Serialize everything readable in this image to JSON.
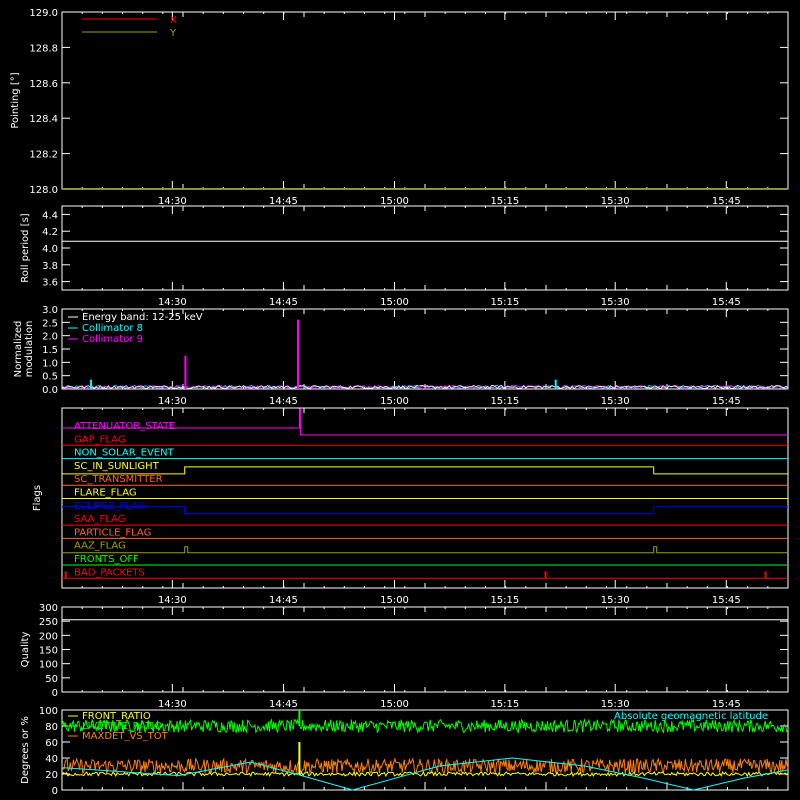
{
  "colors": {
    "background": "#000000",
    "axes": "#ffffff",
    "red": "#ff0000",
    "yellow": "#ffff00",
    "olive": "#a0a000",
    "cyan": "#00ffff",
    "magenta": "#ff00ff",
    "orange": "#ff8000",
    "blue": "#0000ff",
    "green": "#00ff00",
    "salmon": "#ff6030"
  },
  "chart_data": [
    {
      "id": "pointing",
      "type": "line",
      "ylabel": "Pointing [°]",
      "ylim": [
        128.0,
        129.0
      ],
      "yticks": [
        "128.0",
        "128.2",
        "128.4",
        "128.6",
        "128.8",
        "129.0"
      ],
      "xticks": [
        "14:30",
        "14:45",
        "15:00",
        "15:15",
        "15:30",
        "15:45"
      ],
      "legend": "top-left",
      "series": [
        {
          "name": "X",
          "color": "red",
          "y": null
        },
        {
          "name": "Y",
          "color": "olive",
          "y": 128.0
        }
      ]
    },
    {
      "id": "roll",
      "type": "line",
      "ylabel": "Roll period [s]",
      "ylim": [
        3.5,
        4.5
      ],
      "yticks": [
        "3.6",
        "3.8",
        "4.0",
        "4.2",
        "4.4"
      ],
      "xticks": [
        "14:30",
        "14:45",
        "15:00",
        "15:15",
        "15:30",
        "15:45"
      ],
      "series": [
        {
          "name": "",
          "color": "axes",
          "y": 4.08
        }
      ]
    },
    {
      "id": "modulation",
      "type": "line",
      "ylabel": [
        "Normalized",
        "modulation"
      ],
      "ylim": [
        0.0,
        3.0
      ],
      "yticks": [
        "0.0",
        "0.5",
        "1.0",
        "1.5",
        "2.0",
        "2.5",
        "3.0"
      ],
      "xticks": [
        "14:30",
        "14:45",
        "15:00",
        "15:15",
        "15:30",
        "15:45"
      ],
      "legend": "top-left",
      "legend_entries": [
        {
          "name": "Energy band: 12-25 keV",
          "color": "axes"
        },
        {
          "name": "Collimator 8",
          "color": "cyan"
        },
        {
          "name": "Collimator 9",
          "color": "magenta"
        }
      ],
      "baseline": 0.05,
      "spikes": [
        {
          "t": 0.04,
          "value": 0.35,
          "color": "cyan"
        },
        {
          "t": 0.17,
          "value": 1.25,
          "color": "magenta"
        },
        {
          "t": 0.325,
          "value": 2.6,
          "color": "magenta"
        },
        {
          "t": 0.68,
          "value": 0.35,
          "color": "cyan"
        }
      ]
    },
    {
      "id": "flags",
      "type": "line",
      "ylabel": "Flags",
      "xticks": [
        "14:30",
        "14:45",
        "15:00",
        "15:15",
        "15:30",
        "15:45"
      ],
      "flags": [
        {
          "name": "ATTENUATOR_STATE",
          "color": "magenta",
          "pattern": "attenuator"
        },
        {
          "name": "GAP_FLAG",
          "color": "red",
          "pattern": "flat"
        },
        {
          "name": "NON_SOLAR_EVENT",
          "color": "cyan",
          "pattern": "flat"
        },
        {
          "name": "SC_IN_SUNLIGHT",
          "color": "yellow",
          "pattern": "sunlight"
        },
        {
          "name": "SC_TRANSMITTER",
          "color": "salmon",
          "pattern": "flat"
        },
        {
          "name": "FLARE_FLAG",
          "color": "yellow",
          "pattern": "flat"
        },
        {
          "name": "ECLIPSE_FLAG",
          "color": "blue",
          "pattern": "eclipse"
        },
        {
          "name": "SAA_FLAG",
          "color": "red",
          "pattern": "flat"
        },
        {
          "name": "PARTICLE_FLAG",
          "color": "salmon",
          "pattern": "flat"
        },
        {
          "name": "AAZ_FLAG",
          "color": "olive",
          "pattern": "aaz"
        },
        {
          "name": "FRONTS_OFF",
          "color": "green",
          "pattern": "flat"
        },
        {
          "name": "BAD_PACKETS",
          "color": "red",
          "pattern": "badpackets"
        }
      ]
    },
    {
      "id": "quality",
      "type": "line",
      "ylabel": "Quality",
      "ylim": [
        0,
        300
      ],
      "yticks": [
        "0",
        "50",
        "100",
        "150",
        "200",
        "250",
        "300"
      ],
      "xticks": [
        "14:30",
        "14:45",
        "15:00",
        "15:15",
        "15:30",
        "15:45"
      ],
      "series": [
        {
          "name": "",
          "color": "axes",
          "y": 255
        }
      ]
    },
    {
      "id": "ratios",
      "type": "line",
      "ylabel": "Degrees or %",
      "ylim": [
        0,
        100
      ],
      "yticks": [
        "0",
        "20",
        "40",
        "60",
        "80",
        "100"
      ],
      "legend": "top-left",
      "legend_entries": [
        {
          "name": "FRONT_RATIO",
          "color": "yellow"
        },
        {
          "name": "LIVETIME_RATIO",
          "color": "green"
        },
        {
          "name": "MAXDET_VS_TOT",
          "color": "orange"
        }
      ],
      "annotation": {
        "text": "Absolute geomagnetic latitude",
        "color": "cyan"
      },
      "levels": {
        "front_ratio": 20,
        "livetime_ratio": 80,
        "maxdet_vs_tot": 30
      }
    }
  ]
}
